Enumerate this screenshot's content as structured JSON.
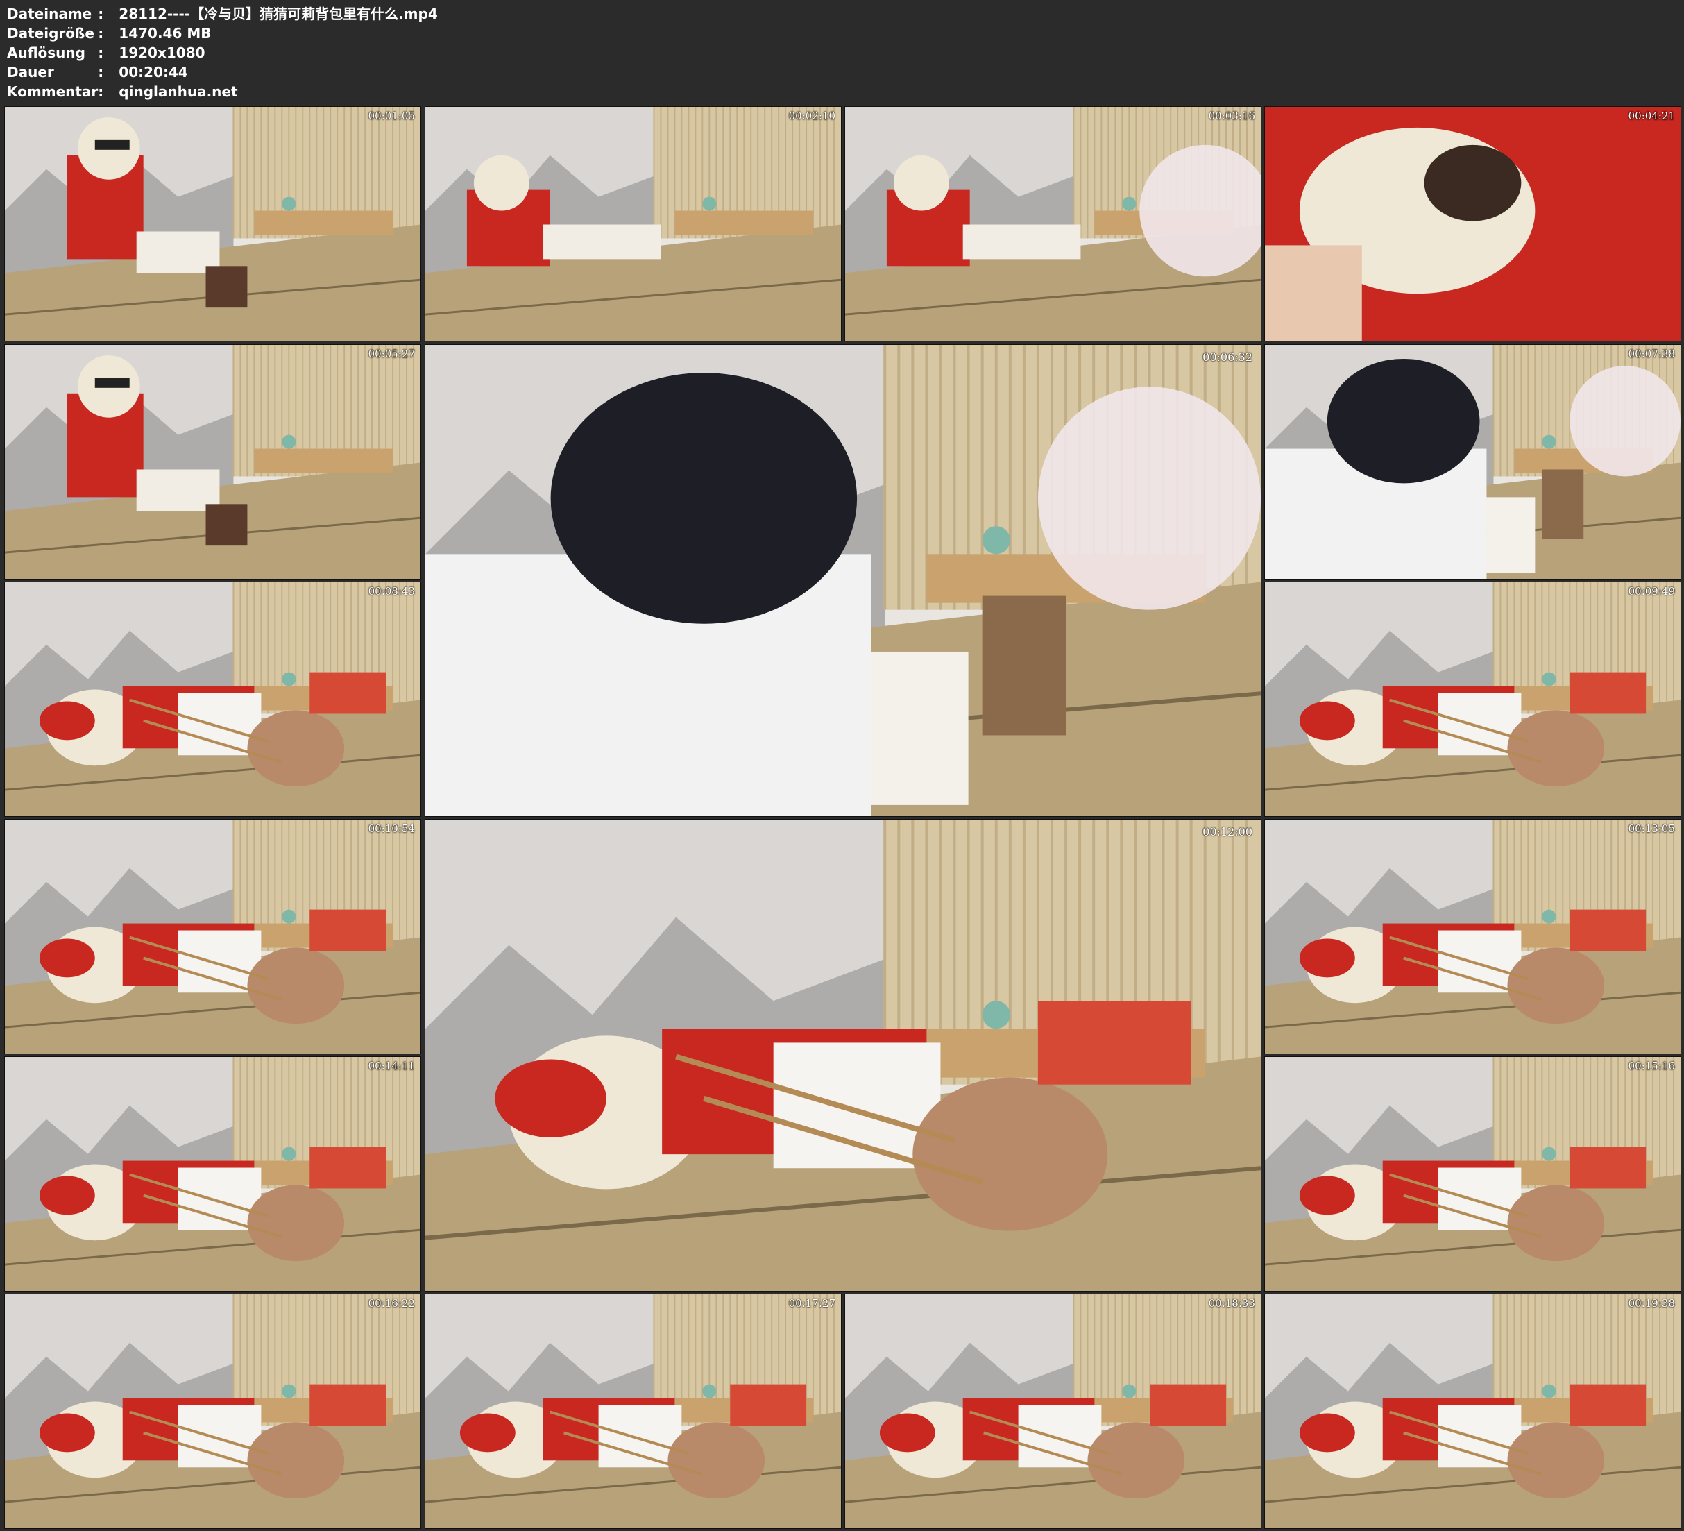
{
  "info": [
    {
      "key": "Dateiname",
      "value": "28112----【冷与贝】猜猜可莉背包里有什么.mp4"
    },
    {
      "key": "Dateigröße",
      "value": "1470.46 MB"
    },
    {
      "key": "Auflösung",
      "value": "1920x1080"
    },
    {
      "key": "Dauer",
      "value": "00:20:44"
    },
    {
      "key": "Kommentar",
      "value": "qinglanhua.net"
    }
  ],
  "separator": ":",
  "thumbnails": [
    {
      "timestamp": "00:01:05",
      "scene": "seated"
    },
    {
      "timestamp": "00:02:10",
      "scene": "reclined"
    },
    {
      "timestamp": "00:03:16",
      "scene": "reclined-umbrella"
    },
    {
      "timestamp": "00:04:21",
      "scene": "closeup"
    },
    {
      "timestamp": "00:05:27",
      "scene": "seated"
    },
    {
      "timestamp": "00:06:32",
      "scene": "person-cap",
      "size": "big"
    },
    {
      "timestamp": "00:07:38",
      "scene": "person-cap-small"
    },
    {
      "timestamp": "00:08:43",
      "scene": "lying"
    },
    {
      "timestamp": "00:09:49",
      "scene": "lying"
    },
    {
      "timestamp": "00:10:54",
      "scene": "lying"
    },
    {
      "timestamp": "00:12:00",
      "scene": "lying",
      "size": "big"
    },
    {
      "timestamp": "00:13:05",
      "scene": "lying"
    },
    {
      "timestamp": "00:14:11",
      "scene": "lying"
    },
    {
      "timestamp": "00:15:16",
      "scene": "lying"
    },
    {
      "timestamp": "00:16:22",
      "scene": "lying"
    },
    {
      "timestamp": "00:17:27",
      "scene": "lying-close"
    },
    {
      "timestamp": "00:18:33",
      "scene": "lying"
    },
    {
      "timestamp": "00:19:38",
      "scene": "lying"
    }
  ],
  "colors": {
    "background": "#2b2b2b",
    "text": "#ffffff",
    "wall": "#e9e6e2",
    "tatami": "#b8a27a",
    "costume_red": "#c8281f",
    "hair": "#efe8d6"
  }
}
